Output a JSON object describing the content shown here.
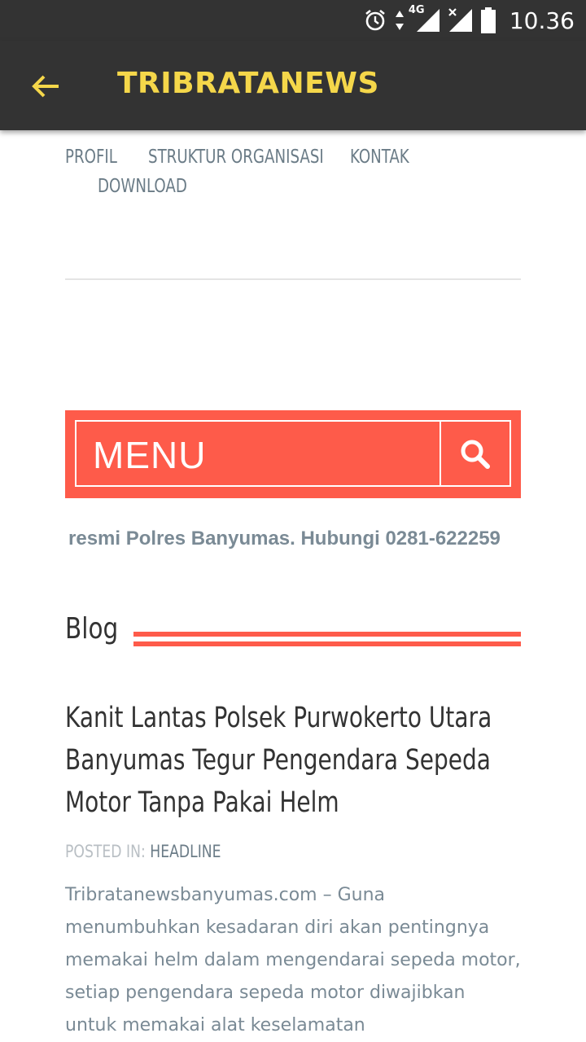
{
  "status_bar": {
    "time": "10.36",
    "network": "4G",
    "icons": [
      "alarm-icon",
      "data-arrows-icon",
      "signal-icon",
      "signal-no-sim-icon",
      "battery-icon"
    ]
  },
  "app_bar": {
    "title": "TRIBRATANEWS",
    "back_icon": "back-arrow-icon",
    "accent_color": "#f5d74a",
    "background_color": "#333333"
  },
  "nav": {
    "items": [
      "PROFIL",
      "STRUKTUR ORGANISASI",
      "KONTAK",
      "DOWNLOAD"
    ]
  },
  "menu_bar": {
    "label": "MENU",
    "search_icon": "search-icon",
    "color": "#fe5b4a"
  },
  "marquee": {
    "text": "resmi Polres Banyumas. Hubungi 0281-622259"
  },
  "blog": {
    "heading": "Blog"
  },
  "post": {
    "title": "Kanit Lantas Polsek Purwokerto Utara Banyumas Tegur Pengendara Sepeda Motor Tanpa Pakai Helm",
    "posted_in_label": "POSTED IN:",
    "category": "HEADLINE",
    "excerpt": "Tribratanewsbanyumas.com – Guna menumbuhkan kesadaran diri akan pentingnya memakai helm dalam mengendarai sepeda motor, setiap pengendara sepeda motor diwajibkan untuk memakai alat keselamatan"
  }
}
